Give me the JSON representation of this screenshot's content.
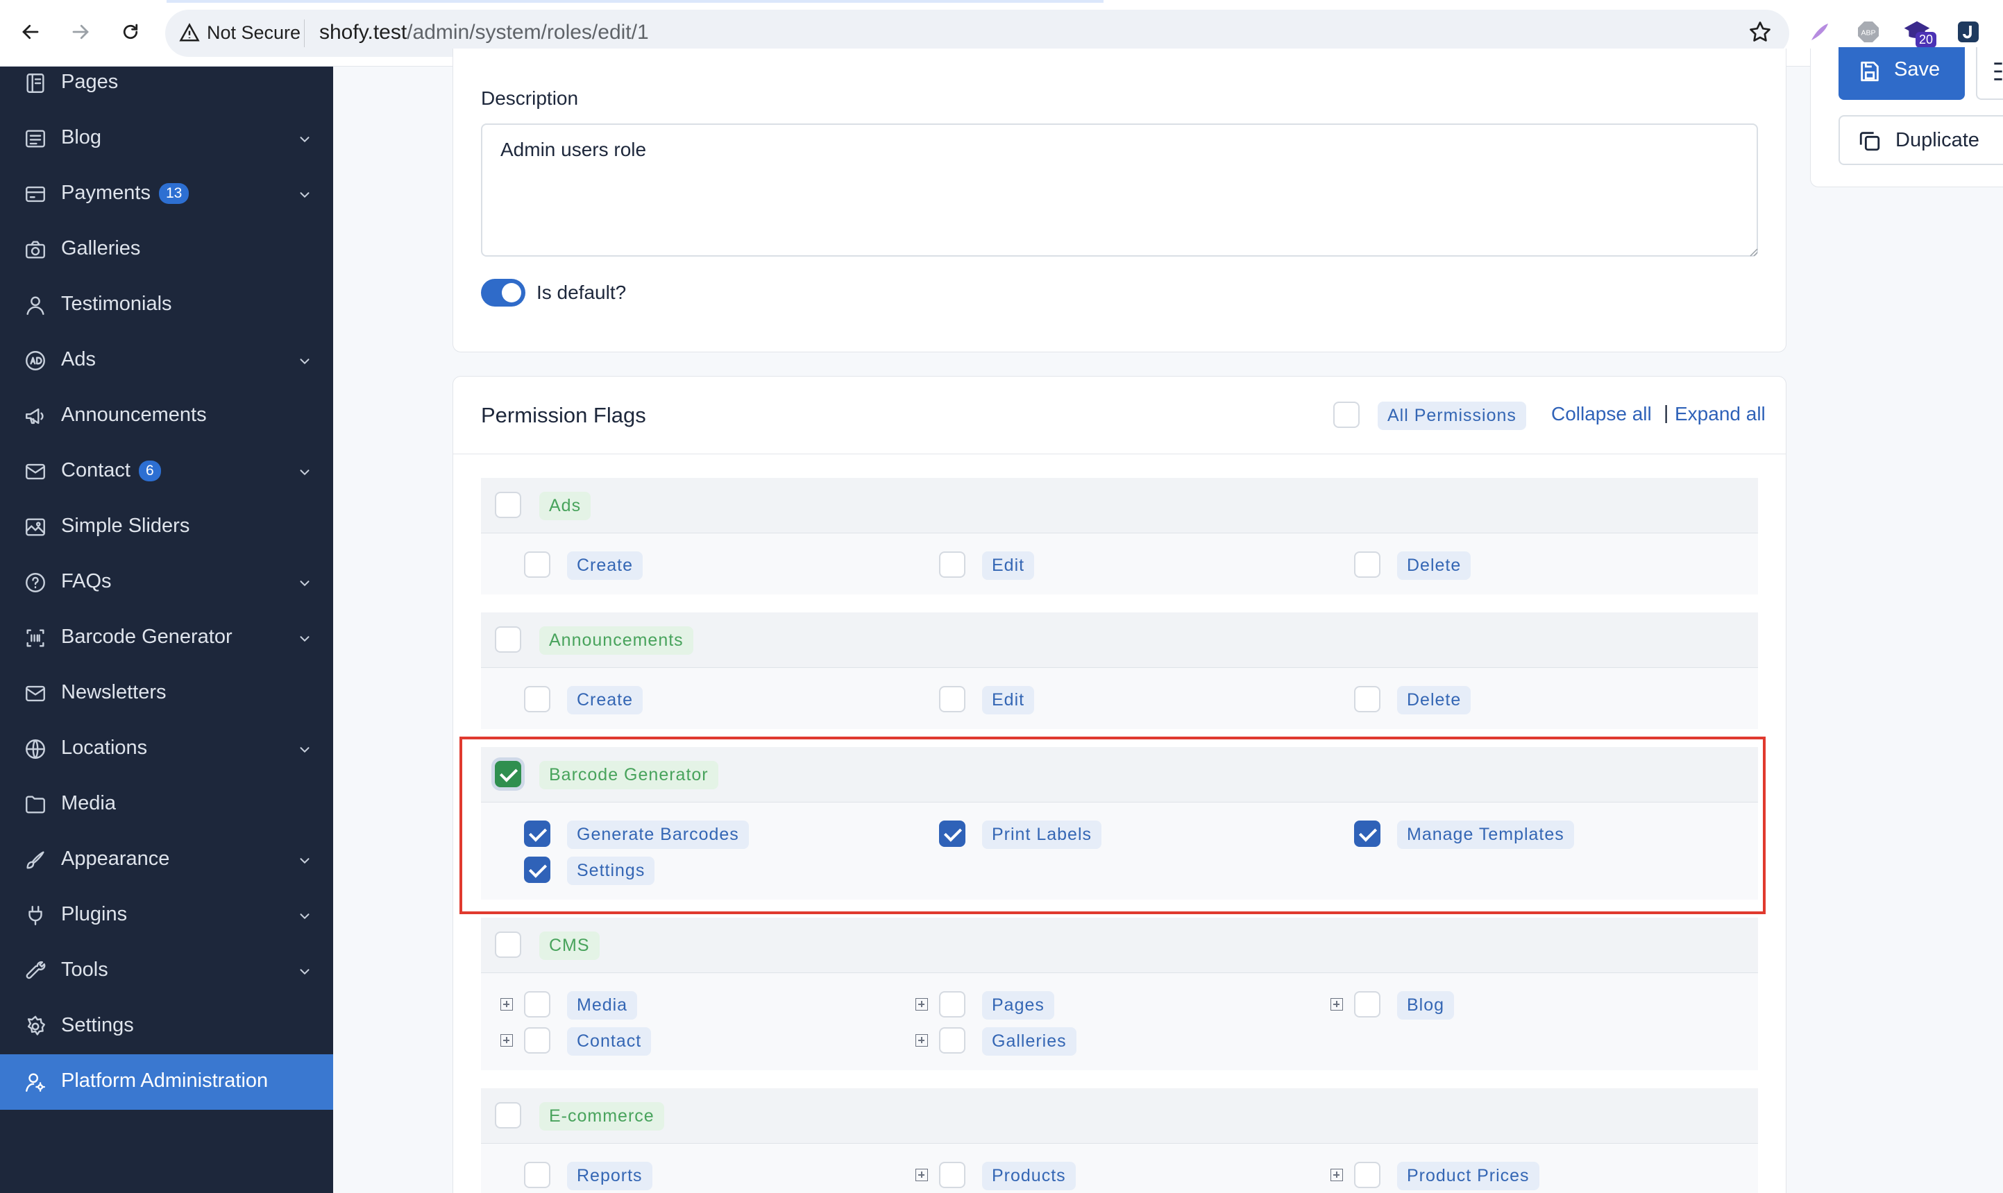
{
  "browser": {
    "security_label": "Not Secure",
    "url_host": "shofy.test",
    "url_path": "/admin/system/roles/edit/1",
    "ext_badge": "20"
  },
  "sidebar": {
    "items": [
      {
        "label": "Pages",
        "icon": "pages-icon",
        "chevron": false
      },
      {
        "label": "Blog",
        "icon": "blog-icon",
        "chevron": true
      },
      {
        "label": "Payments",
        "icon": "payments-icon",
        "chevron": true,
        "badge": "13"
      },
      {
        "label": "Galleries",
        "icon": "camera-icon",
        "chevron": false
      },
      {
        "label": "Testimonials",
        "icon": "user-icon",
        "chevron": false
      },
      {
        "label": "Ads",
        "icon": "ad-icon",
        "chevron": true
      },
      {
        "label": "Announcements",
        "icon": "megaphone-icon",
        "chevron": false
      },
      {
        "label": "Contact",
        "icon": "mail-icon",
        "chevron": true,
        "badge": "6"
      },
      {
        "label": "Simple Sliders",
        "icon": "slider-icon",
        "chevron": false
      },
      {
        "label": "FAQs",
        "icon": "question-icon",
        "chevron": true
      },
      {
        "label": "Barcode Generator",
        "icon": "barcode-icon",
        "chevron": true
      },
      {
        "label": "Newsletters",
        "icon": "mail-icon",
        "chevron": false
      },
      {
        "label": "Locations",
        "icon": "globe-icon",
        "chevron": true
      },
      {
        "label": "Media",
        "icon": "folder-icon",
        "chevron": false
      },
      {
        "label": "Appearance",
        "icon": "brush-icon",
        "chevron": true
      },
      {
        "label": "Plugins",
        "icon": "plug-icon",
        "chevron": true
      },
      {
        "label": "Tools",
        "icon": "tools-icon",
        "chevron": true
      },
      {
        "label": "Settings",
        "icon": "gear-icon",
        "chevron": false
      },
      {
        "label": "Platform Administration",
        "icon": "user-gear-icon",
        "chevron": false,
        "active": true
      }
    ]
  },
  "form": {
    "description_label": "Description",
    "description_value": "Admin users role",
    "is_default_label": "Is default?",
    "is_default": true
  },
  "actions": {
    "save_label": "Save",
    "duplicate_label": "Duplicate"
  },
  "permissions": {
    "title": "Permission Flags",
    "all_label": "All Permissions",
    "collapse_all": "Collapse all",
    "separator": "|",
    "expand_all": "Expand all",
    "groups": [
      {
        "name": "Ads",
        "checked": false,
        "items": [
          {
            "label": "Create",
            "checked": false
          },
          {
            "label": "Edit",
            "checked": false
          },
          {
            "label": "Delete",
            "checked": false
          }
        ]
      },
      {
        "name": "Announcements",
        "checked": false,
        "items": [
          {
            "label": "Create",
            "checked": false
          },
          {
            "label": "Edit",
            "checked": false
          },
          {
            "label": "Delete",
            "checked": false
          }
        ]
      },
      {
        "name": "Barcode Generator",
        "checked": true,
        "items": [
          {
            "label": "Generate Barcodes",
            "checked": true
          },
          {
            "label": "Print Labels",
            "checked": true
          },
          {
            "label": "Manage Templates",
            "checked": true
          },
          {
            "label": "Settings",
            "checked": true
          }
        ]
      },
      {
        "name": "CMS",
        "checked": false,
        "items": [
          {
            "label": "Media",
            "checked": false,
            "expandable": true
          },
          {
            "label": "Pages",
            "checked": false,
            "expandable": true
          },
          {
            "label": "Blog",
            "checked": false,
            "expandable": true
          },
          {
            "label": "Contact",
            "checked": false,
            "expandable": true
          },
          {
            "label": "Galleries",
            "checked": false,
            "expandable": true
          }
        ]
      },
      {
        "name": "E-commerce",
        "checked": false,
        "items": [
          {
            "label": "Reports",
            "checked": false
          },
          {
            "label": "Products",
            "checked": false,
            "expandable": true
          },
          {
            "label": "Product Prices",
            "checked": false,
            "expandable": true
          }
        ]
      }
    ]
  }
}
